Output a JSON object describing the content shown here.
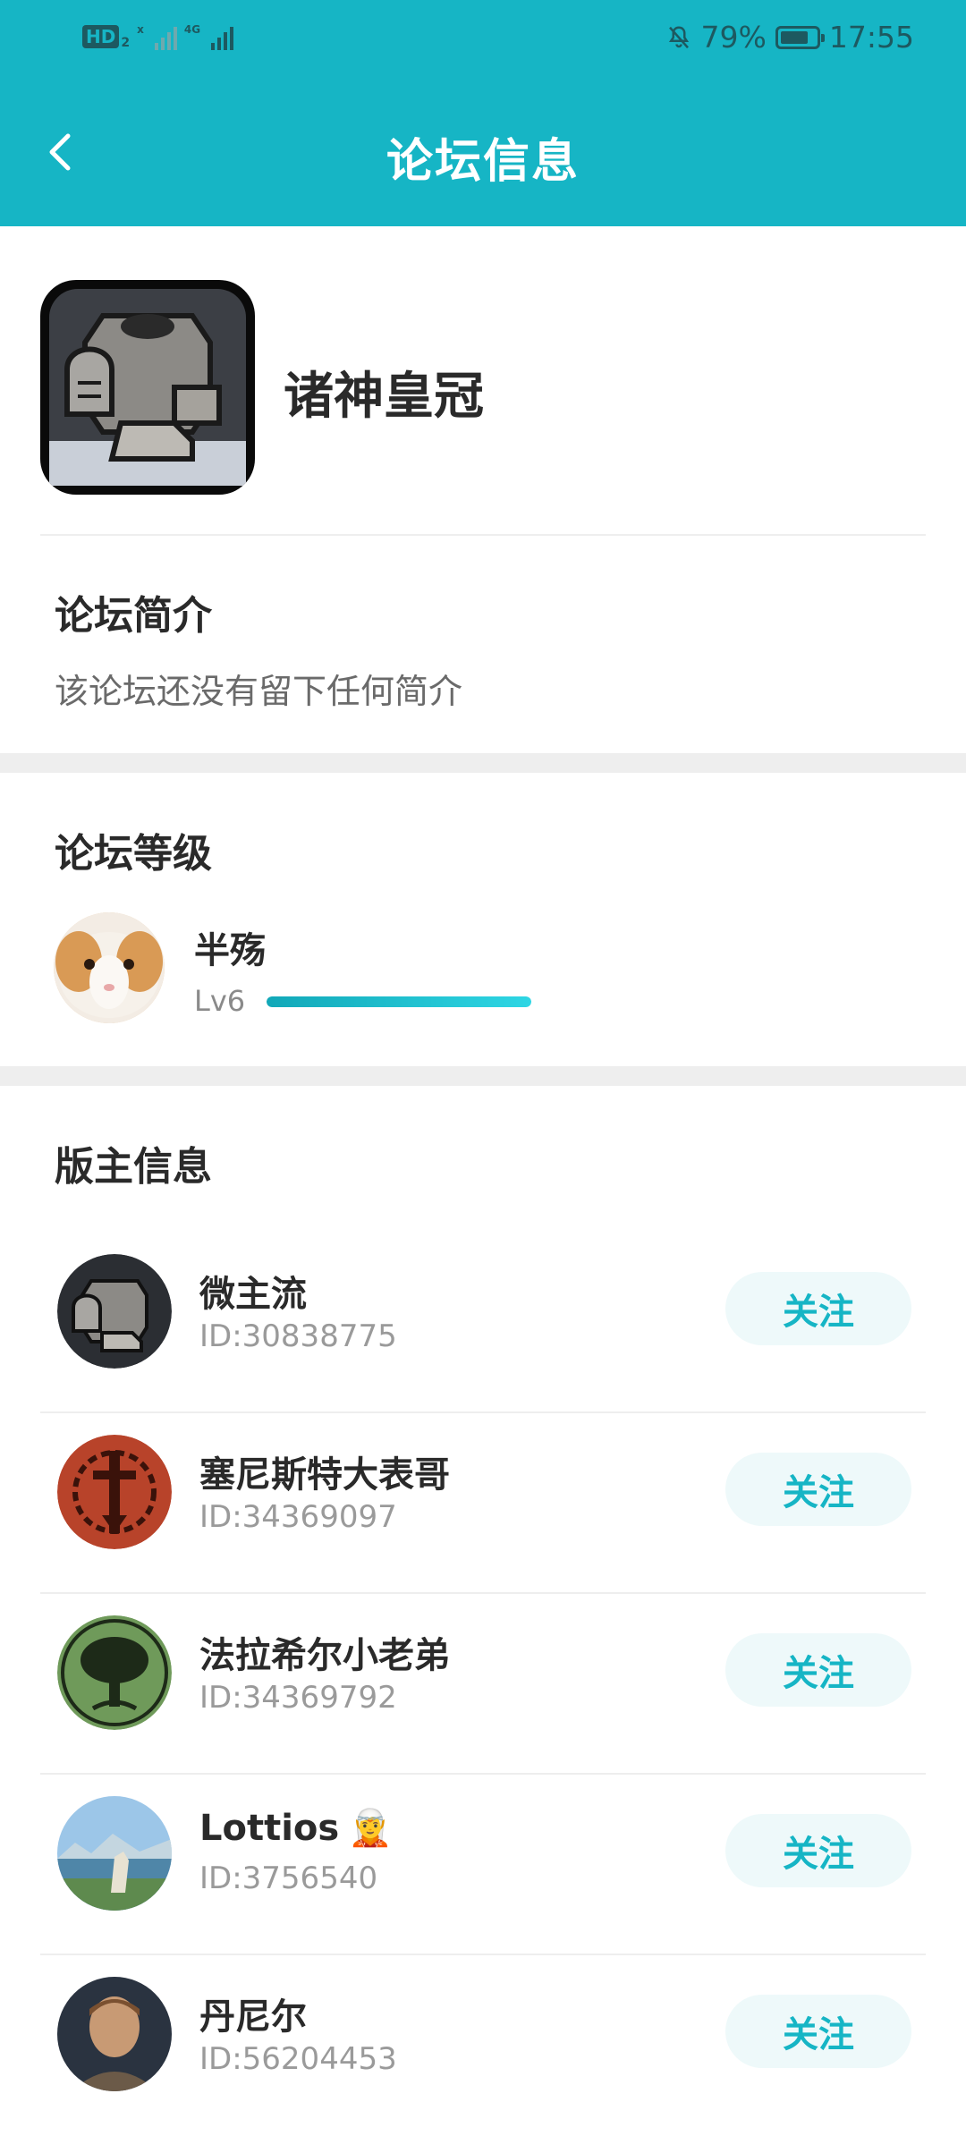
{
  "status_bar": {
    "hd_label": "HD",
    "hd_sub": "2",
    "signal1_tag": "x",
    "signal2_tag": "4G",
    "battery_percent": "79%",
    "battery_level": 0.79,
    "time": "17:55"
  },
  "navbar": {
    "title": "论坛信息"
  },
  "forum": {
    "name": "诸神皇冠",
    "icon": "armor-icon"
  },
  "intro": {
    "title": "论坛简介",
    "text": "该论坛还没有留下任何简介"
  },
  "level": {
    "title": "论坛等级",
    "user_name": "半殇",
    "level_label": "Lv6",
    "progress": 1.0,
    "avatar": "guinea-pig-avatar"
  },
  "moderators": {
    "title": "版主信息",
    "follow_label": "关注",
    "items": [
      {
        "name": "微主流",
        "id": "ID:30838775",
        "avatar": "armor-avatar",
        "emoji": ""
      },
      {
        "name": "塞尼斯特大表哥",
        "id": "ID:34369097",
        "avatar": "red-emblem-avatar",
        "emoji": ""
      },
      {
        "name": "法拉希尔小老弟",
        "id": "ID:34369792",
        "avatar": "tree-emblem-avatar",
        "emoji": ""
      },
      {
        "name": "Lottios",
        "id": "ID:3756540",
        "avatar": "landscape-avatar",
        "emoji": "🧝"
      },
      {
        "name": "丹尼尔",
        "id": "ID:56204453",
        "avatar": "portrait-avatar",
        "emoji": ""
      }
    ]
  },
  "colors": {
    "accent": "#16b5c5",
    "follow_bg": "#eef9fa"
  }
}
